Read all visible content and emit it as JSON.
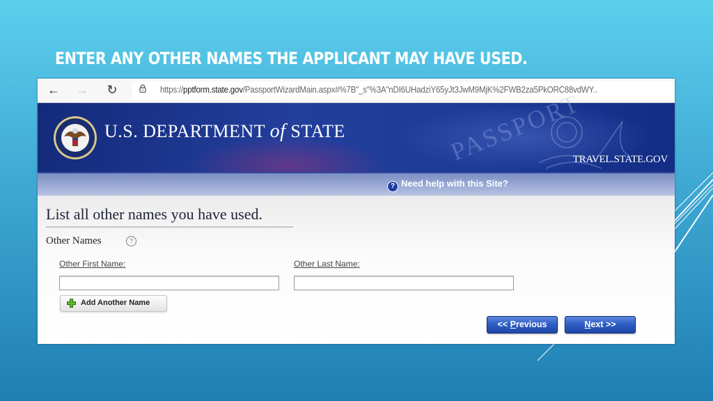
{
  "slide": {
    "title": "ENTER ANY OTHER NAMES THE APPLICANT MAY HAVE USED.",
    "colors": {
      "background_top": "#5ccfec",
      "background_bottom": "#1f7fb3",
      "title": "#ffffff"
    }
  },
  "browser": {
    "back_icon": "arrow-left-icon",
    "forward_icon": "arrow-right-icon",
    "reload_icon": "reload-icon",
    "lock_icon": "lock-icon",
    "url_prefix": "https://",
    "url_domain": "pptform.state.gov",
    "url_path": "/PassportWizardMain.aspx#%7B\"_s\"%3A\"nDI6UHadziY65yJt3JwM9MjK%2FWB2za5PkORC88vdWY..",
    "glyphs": {
      "back": "←",
      "forward": "→",
      "reload": "↻"
    }
  },
  "banner": {
    "seal_icon": "department-of-state-seal",
    "dept_part1": "U.S. DEPARTMENT ",
    "dept_of": "of",
    "dept_part2": " STATE",
    "watermark": "PASSPORT",
    "travel_link": "TRAVEL.STATE.GOV",
    "colors": {
      "banner": "#1c3a96"
    }
  },
  "help_bar": {
    "icon": "question-circle-icon",
    "icon_glyph": "?",
    "label": "Need help with this Site?"
  },
  "form": {
    "heading": "List all other names you have used.",
    "section_label": "Other Names",
    "section_help_glyph": "?",
    "first_name_label": "Other First Name:",
    "first_name_value": "",
    "last_name_label": "Other Last Name:",
    "last_name_value": "",
    "add_button_label": "Add Another Name",
    "add_button_icon": "plus-icon",
    "previous_prefix": "<< ",
    "previous_underline": "P",
    "previous_rest": "revious",
    "next_underline": "N",
    "next_rest": "ext >>",
    "colors": {
      "button_primary": "#2d5cc2",
      "add_icon": "#5cb82e"
    }
  }
}
